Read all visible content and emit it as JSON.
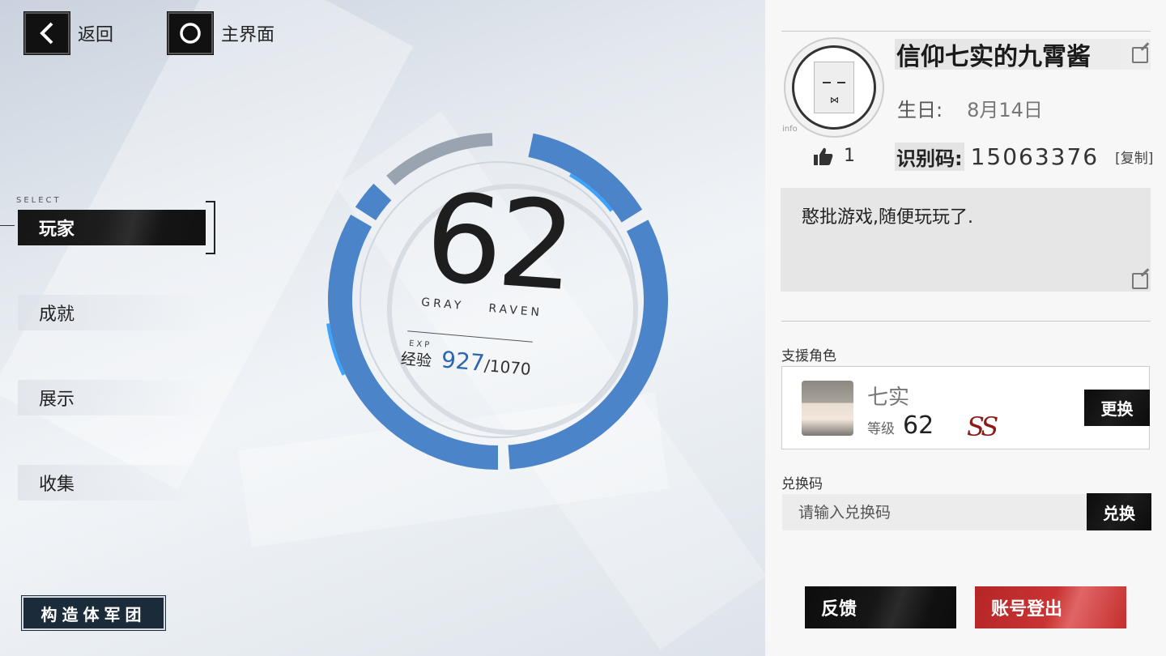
{
  "nav": {
    "back_label": "返回",
    "home_label": "主界面"
  },
  "menu": {
    "select_tag": "SELECT",
    "items": [
      {
        "label": "玩家"
      },
      {
        "label": "成就"
      },
      {
        "label": "展示"
      },
      {
        "label": "收集"
      }
    ],
    "corps_label": "构造体军团"
  },
  "level": {
    "value": "62",
    "subtitle": "GRAY RAVEN",
    "exp_tag": "EXP",
    "exp_label": "经验",
    "exp_current": "927",
    "exp_max": "/1070",
    "exp_fraction": 0.866
  },
  "profile": {
    "name": "信仰七实的九霄酱",
    "avatar_tag": "info",
    "likes": "1",
    "birthday_label": "生日:",
    "birthday_value": "8月14日",
    "uid_label": "识别码:",
    "uid_value": "15063376",
    "copy_label": "[复制]",
    "signature": "憨批游戏,随便玩玩了."
  },
  "support": {
    "section_label": "支援角色",
    "char_name": "七实",
    "level_label": "等级",
    "level_value": "62",
    "rank": "SS",
    "change_label": "更换"
  },
  "redeem": {
    "section_label": "兑换码",
    "placeholder": "请输入兑换码",
    "button_label": "兑换"
  },
  "footer": {
    "feedback_label": "反馈",
    "logout_label": "账号登出"
  },
  "colors": {
    "ring_blue": "#4b84c8",
    "logout_red": "#c73030"
  }
}
